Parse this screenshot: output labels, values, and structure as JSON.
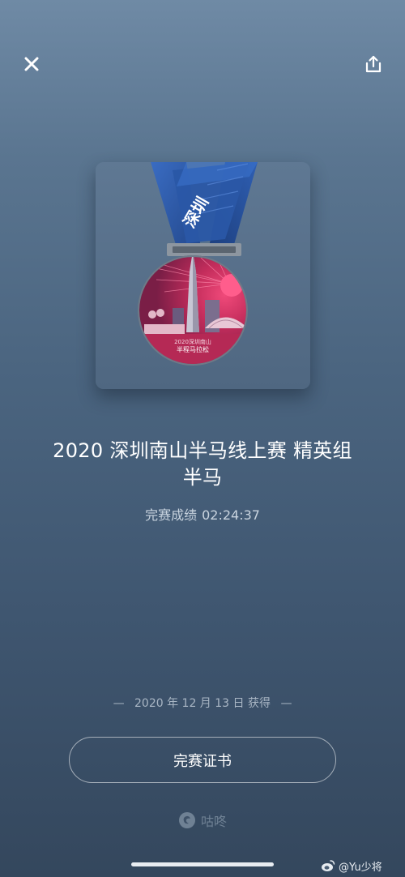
{
  "header": {
    "close_icon": "close-icon",
    "share_icon": "share-icon"
  },
  "medal": {
    "ribbon_text": "深圳",
    "medal_caption_line1": "2020深圳南山",
    "medal_caption_line2": "半程马拉松"
  },
  "event": {
    "title_line1": "2020 深圳南山半马线上赛 精英组",
    "title_line2": "半马",
    "result_label": "完赛成绩",
    "result_time": "02:24:37"
  },
  "award": {
    "date": "2020 年 12 月 13 日 获得",
    "dash": "—"
  },
  "certificate": {
    "button_label": "完赛证书"
  },
  "brand": {
    "name": "咕咚",
    "icon": "codoon-logo-icon"
  },
  "watermark": {
    "text": "@Yu少将",
    "icon": "weibo-icon"
  },
  "colors": {
    "background_top": "#6f8aa5",
    "background_bottom": "#34475d",
    "ribbon_blue": "#2e5aa8",
    "medal_red": "#b8294f",
    "medal_pink": "#d14a78"
  }
}
